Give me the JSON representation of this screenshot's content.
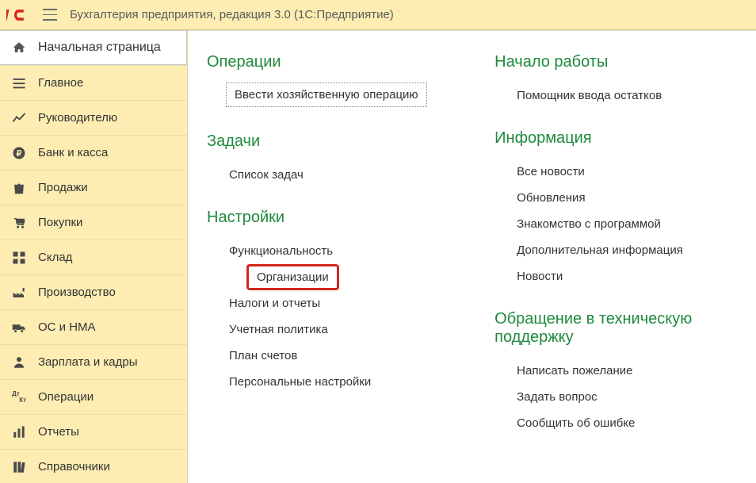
{
  "titlebar": {
    "title": "Бухгалтерия предприятия, редакция 3.0   (1С:Предприятие)"
  },
  "nav": {
    "items": [
      {
        "label": "Начальная страница",
        "icon": "home"
      },
      {
        "label": "Главное",
        "icon": "menu"
      },
      {
        "label": "Руководителю",
        "icon": "chart"
      },
      {
        "label": "Банк и касса",
        "icon": "ruble"
      },
      {
        "label": "Продажи",
        "icon": "bag"
      },
      {
        "label": "Покупки",
        "icon": "cart"
      },
      {
        "label": "Склад",
        "icon": "grid"
      },
      {
        "label": "Производство",
        "icon": "factory"
      },
      {
        "label": "ОС и НМА",
        "icon": "truck"
      },
      {
        "label": "Зарплата и кадры",
        "icon": "person"
      },
      {
        "label": "Операции",
        "icon": "dtkt"
      },
      {
        "label": "Отчеты",
        "icon": "barchart"
      },
      {
        "label": "Справочники",
        "icon": "books"
      }
    ]
  },
  "content": {
    "left": {
      "sections": [
        {
          "title": "Операции",
          "links": [
            {
              "label": "Ввести хозяйственную операцию",
              "style": "boxed"
            }
          ]
        },
        {
          "title": "Задачи",
          "links": [
            {
              "label": "Список задач"
            }
          ]
        },
        {
          "title": "Настройки",
          "links": [
            {
              "label": "Функциональность"
            },
            {
              "label": "Организации",
              "style": "highlight"
            },
            {
              "label": "Налоги и отчеты"
            },
            {
              "label": "Учетная политика"
            },
            {
              "label": "План счетов"
            },
            {
              "label": "Персональные настройки"
            }
          ]
        }
      ]
    },
    "right": {
      "sections": [
        {
          "title": "Начало работы",
          "links": [
            {
              "label": "Помощник ввода остатков"
            }
          ]
        },
        {
          "title": "Информация",
          "links": [
            {
              "label": "Все новости"
            },
            {
              "label": "Обновления"
            },
            {
              "label": "Знакомство с программой"
            },
            {
              "label": "Дополнительная информация"
            },
            {
              "label": "Новости"
            }
          ]
        },
        {
          "title": "Обращение в техническую поддержку",
          "links": [
            {
              "label": "Написать пожелание"
            },
            {
              "label": "Задать вопрос"
            },
            {
              "label": "Сообщить об ошибке"
            }
          ]
        }
      ]
    }
  }
}
